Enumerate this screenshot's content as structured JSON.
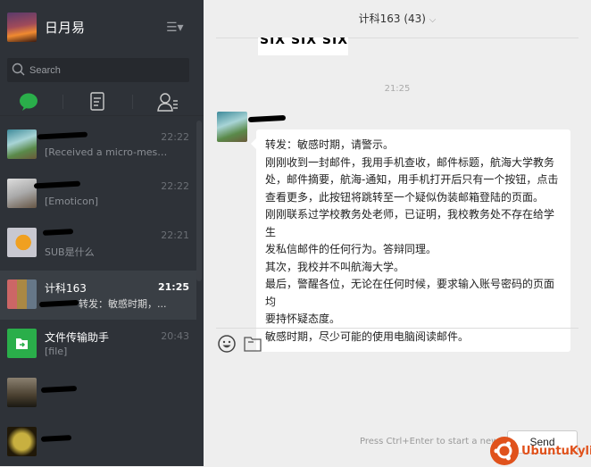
{
  "profile": {
    "name": "日月易"
  },
  "search": {
    "placeholder": "Search"
  },
  "tabs": [
    {
      "icon": "chat-icon",
      "active": true
    },
    {
      "icon": "document-icon"
    },
    {
      "icon": "contacts-icon"
    }
  ],
  "chats": [
    {
      "time": "22:22",
      "preview": "[Received a micro-messa..."
    },
    {
      "time": "22:22",
      "preview": "[Emoticon]"
    },
    {
      "time": "22:21",
      "preview": "SUB是什么"
    },
    {
      "name": "计科163",
      "time": "21:25",
      "preview": "转发：敏感时期，...",
      "selected": true
    },
    {
      "name": "文件传输助手",
      "time": "20:43",
      "preview": "[file]"
    },
    {},
    {}
  ],
  "conversation": {
    "title": "计科163 (43)",
    "image_text": "SIX SIX SIX",
    "time": "21:25",
    "message_lines": [
      "转发：敏感时期，请警示。",
      "刚刚收到一封邮件，我用手机查收，邮件标题，航海大学教务",
      "处，邮件摘要，航海-通知，用手机打开后只有一个按钮，点击",
      "查看更多，此按钮将跳转至一个疑似伪装邮箱登陆的页面。",
      "刚刚联系过学校教务处老师，已证明，我校教务处不存在给学生",
      "发私信邮件的任何行为。答辩同理。",
      "其次，我校并不叫航海大学。",
      "最后，警醒各位，无论在任何时候，要求输入账号密码的页面均",
      "要持怀疑态度。",
      "敏感时期，尽少可能的使用电脑阅读邮件。"
    ]
  },
  "composer": {
    "hint": "Press Ctrl+Enter to start a new line",
    "send_label": "Send"
  },
  "watermark": {
    "text": "UbuntuKylin"
  },
  "colors": {
    "sidebar": "#2e3238",
    "selected": "#3a3f45",
    "accent_green": "#2aae4a",
    "chat_bg": "#eeeeee",
    "watermark": "#e0521c"
  }
}
